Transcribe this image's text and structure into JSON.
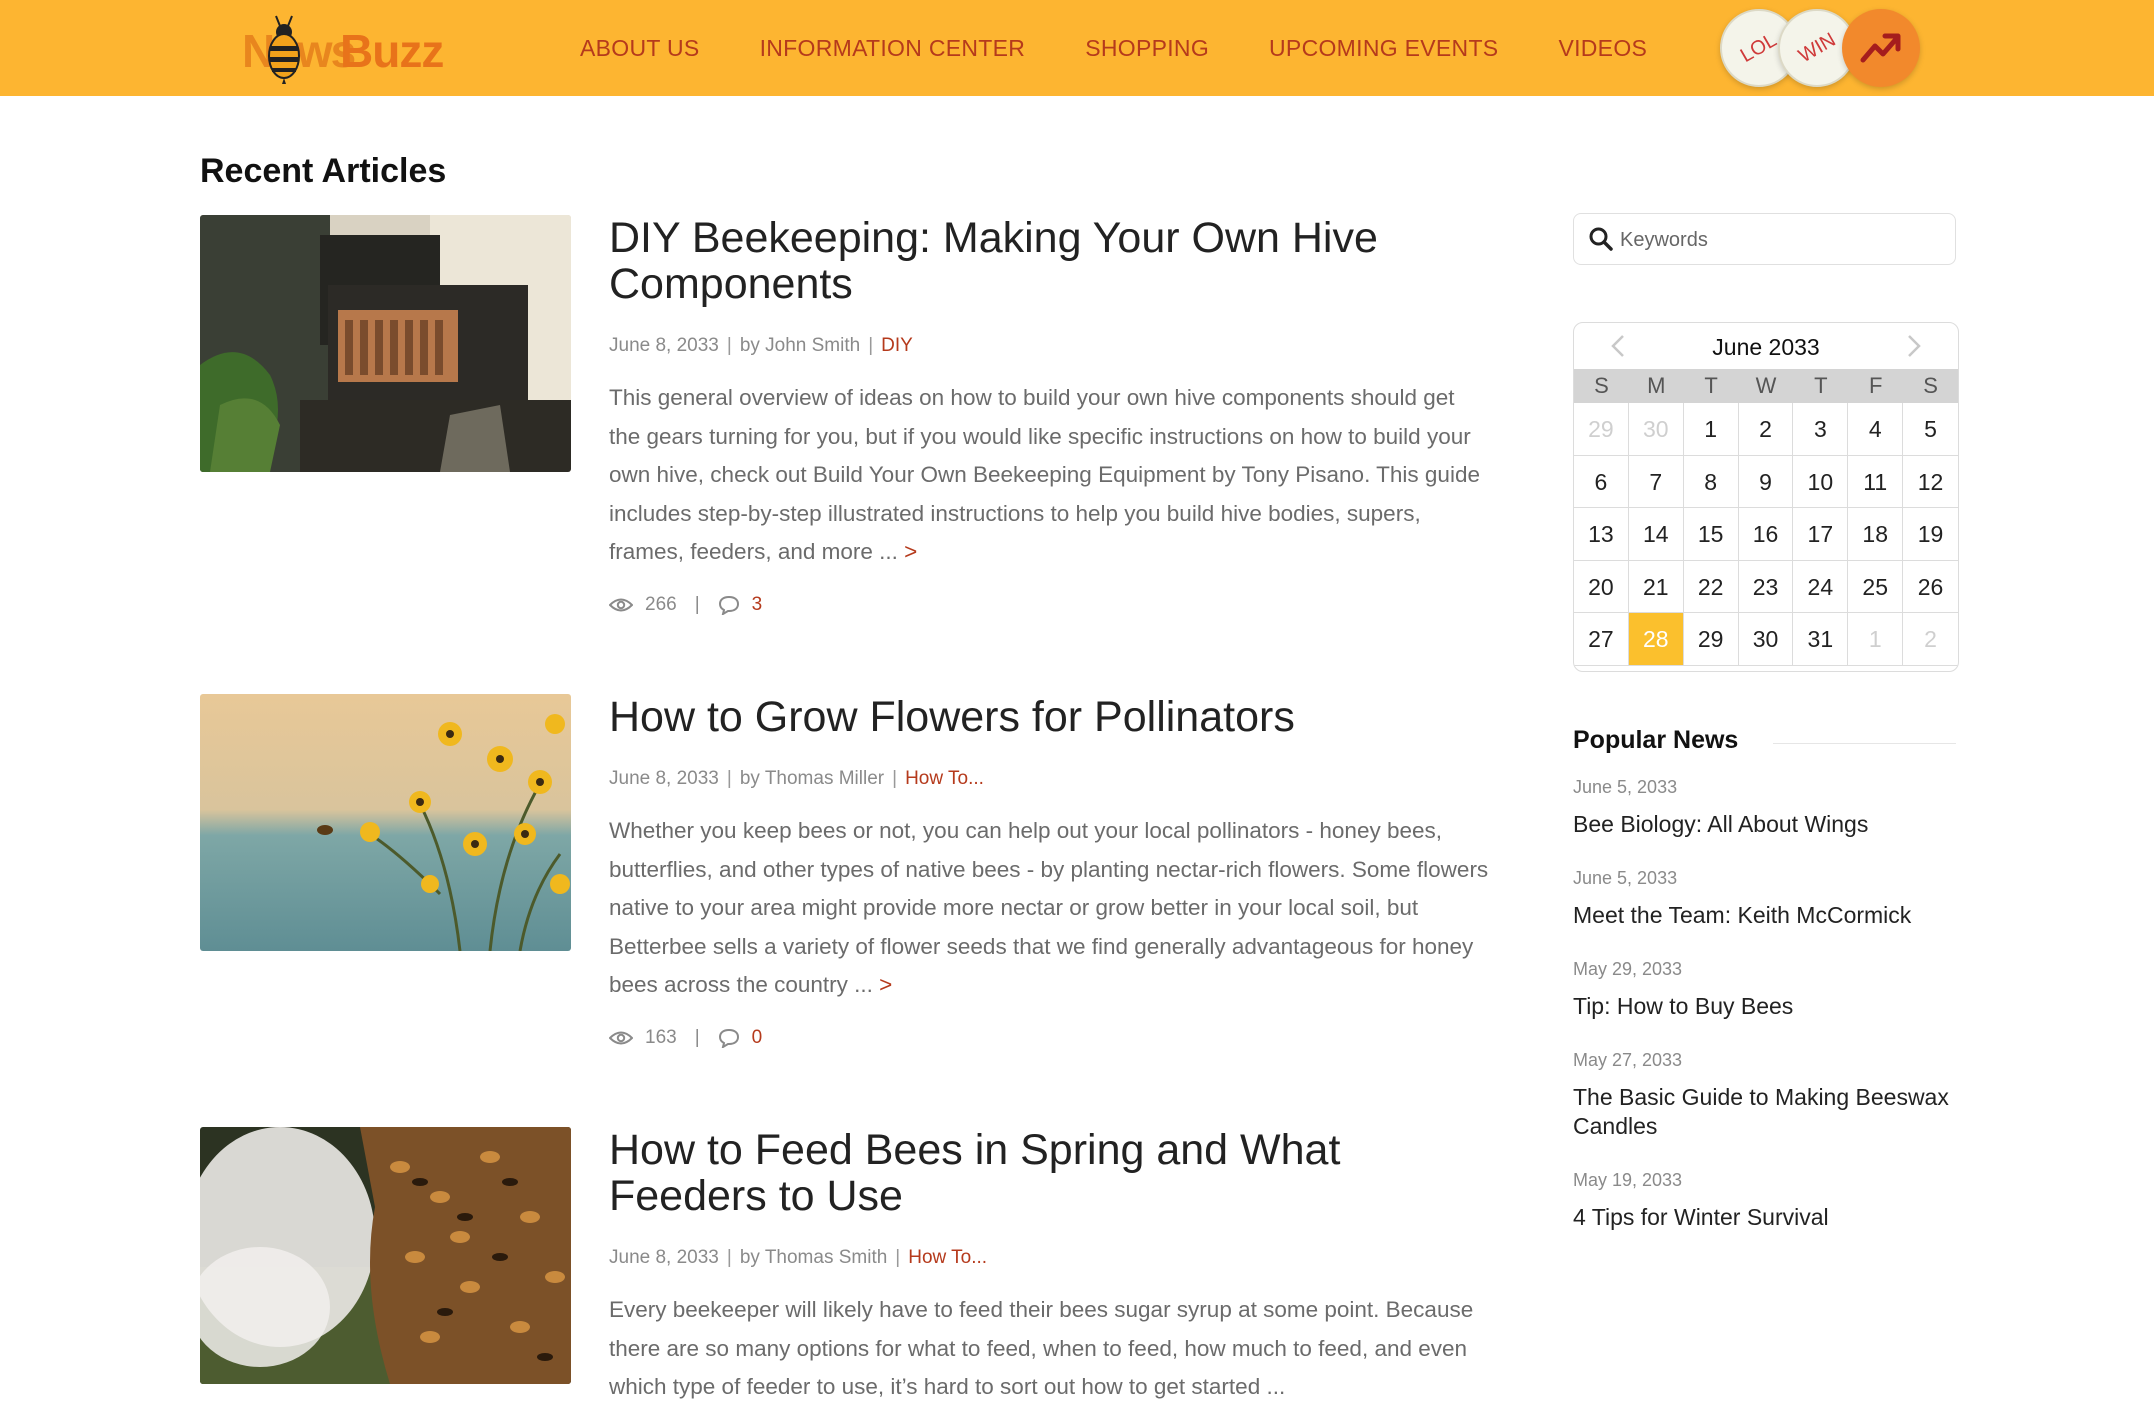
{
  "header": {
    "logo": {
      "word1": "News",
      "word2": "Buzz"
    },
    "nav": [
      "ABOUT US",
      "INFORMATION CENTER",
      "SHOPPING",
      "UPCOMING EVENTS",
      "VIDEOS"
    ],
    "badges": {
      "lol": "LOL",
      "win": "WIN"
    },
    "colors": {
      "bar": "#fdb531",
      "nav_text": "#b53a1c"
    }
  },
  "main": {
    "section_title": "Recent Articles",
    "articles": [
      {
        "title": "DIY Beekeeping: Making Your Own Hive Components",
        "date": "June 8, 2033",
        "author": "by John Smith",
        "category": "DIY",
        "excerpt": "This general overview of ideas on how to build your own hive components should get the gears turning for you, but if you would like specific instructions on how to build your own hive, check out Build Your Own Beekeeping Equipment by Tony Pisano. This guide includes step-by-step illustrated instructions to help you build hive bodies, supers, frames, feeders, and more ...",
        "more": ">",
        "views": "266",
        "comments": "3",
        "image_icon": "beehive-photo"
      },
      {
        "title": "How to Grow Flowers for Pollinators",
        "date": "June 8, 2033",
        "author": "by Thomas Miller",
        "category": "How To...",
        "excerpt": "Whether you keep bees or not, you can help out your local pollinators - honey bees, butterflies, and other types of native bees - by planting nectar-rich flowers. Some flowers native to your area might provide more nectar or grow better in your local soil, but Betterbee sells a variety of flower seeds that we find generally advantageous for honey bees across the country ...",
        "more": ">",
        "views": "163",
        "comments": "0",
        "image_icon": "flowers-photo"
      },
      {
        "title": "How to Feed Bees in Spring and What Feeders to Use",
        "date": "June 8, 2033",
        "author": "by Thomas Smith",
        "category": "How To...",
        "excerpt": "Every beekeeper will likely have to feed their bees sugar syrup at some point. Because there are so many options for what to feed, when to feed, how much to feed, and even which type of feeder to use, it’s hard to sort out how to get started ...",
        "image_icon": "bee-swarm-photo"
      }
    ]
  },
  "sidebar": {
    "search": {
      "placeholder": "Keywords",
      "value": ""
    },
    "calendar": {
      "title": "June 2033",
      "weekdays": [
        "S",
        "M",
        "T",
        "W",
        "T",
        "F",
        "S"
      ],
      "days": [
        {
          "d": "29",
          "m": true
        },
        {
          "d": "30",
          "m": true
        },
        {
          "d": "1"
        },
        {
          "d": "2"
        },
        {
          "d": "3"
        },
        {
          "d": "4"
        },
        {
          "d": "5"
        },
        {
          "d": "6"
        },
        {
          "d": "7"
        },
        {
          "d": "8"
        },
        {
          "d": "9"
        },
        {
          "d": "10"
        },
        {
          "d": "11"
        },
        {
          "d": "12"
        },
        {
          "d": "13"
        },
        {
          "d": "14"
        },
        {
          "d": "15"
        },
        {
          "d": "16"
        },
        {
          "d": "17"
        },
        {
          "d": "18"
        },
        {
          "d": "19"
        },
        {
          "d": "20"
        },
        {
          "d": "21"
        },
        {
          "d": "22"
        },
        {
          "d": "23"
        },
        {
          "d": "24"
        },
        {
          "d": "25"
        },
        {
          "d": "26"
        },
        {
          "d": "27"
        },
        {
          "d": "28",
          "t": true
        },
        {
          "d": "29"
        },
        {
          "d": "30"
        },
        {
          "d": "31"
        },
        {
          "d": "1",
          "m": true
        },
        {
          "d": "2",
          "m": true
        }
      ],
      "today_color": "#fbc02d"
    },
    "popular": {
      "title": "Popular News",
      "items": [
        {
          "date": "June 5, 2033",
          "title": "Bee Biology: All About Wings"
        },
        {
          "date": "June 5, 2033",
          "title": "Meet the Team: Keith McCormick"
        },
        {
          "date": "May 29, 2033",
          "title": "Tip: How to Buy Bees"
        },
        {
          "date": "May 27, 2033",
          "title": "The Basic Guide to Making Beeswax Candles"
        },
        {
          "date": "May 19, 2033",
          "title": "4 Tips for Winter Survival"
        }
      ]
    }
  }
}
